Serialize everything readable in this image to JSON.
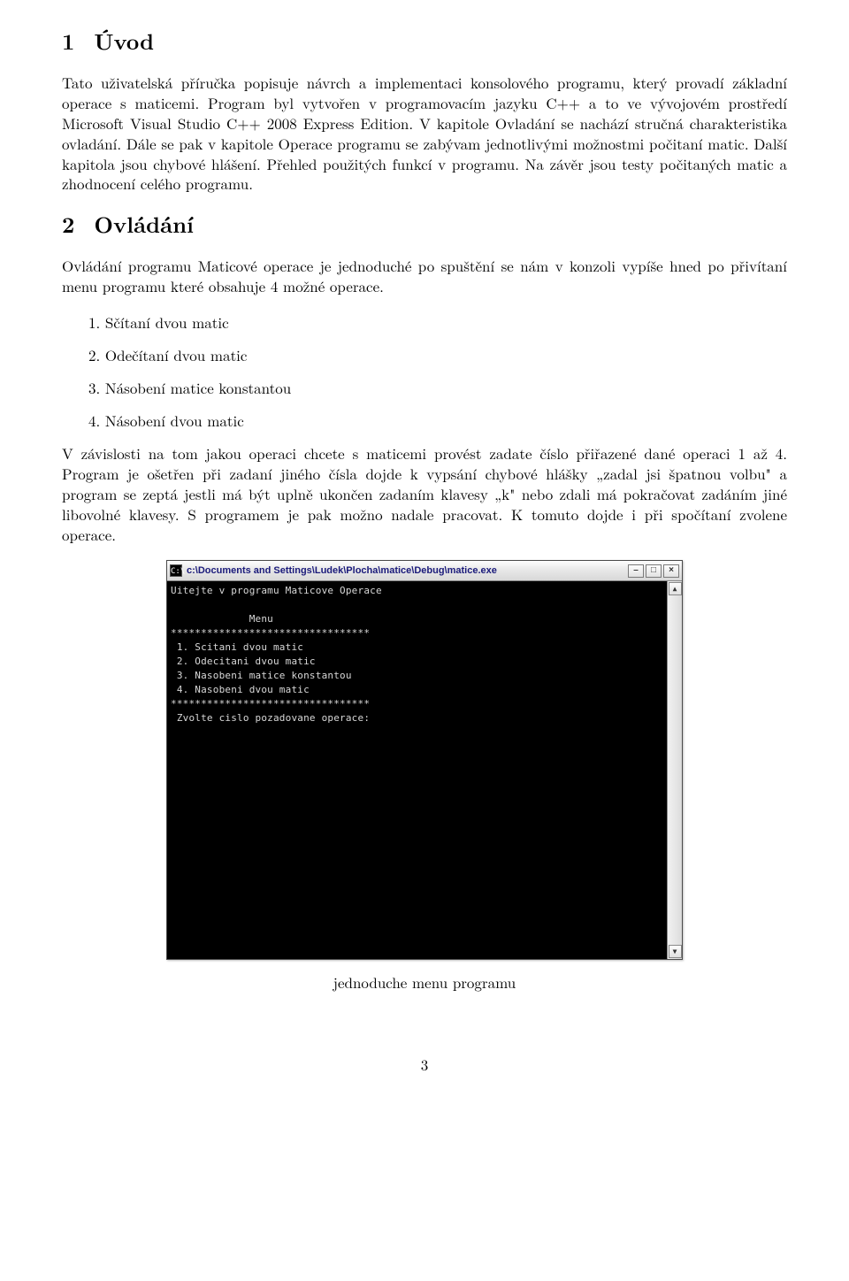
{
  "section1": {
    "num": "1",
    "title": "Úvod",
    "para": "Tato uživatelská příručka popisuje návrch a implementaci konsolového programu, který provadí základní operace s maticemi. Program byl vytvořen v programovacím jazyku C++ a to ve vývojovém prostředí Microsoft Visual Studio C++ 2008 Express Edition. V kapitole Ovladání se nachází stručná charakteristika ovladání. Dále se pak v kapitole Operace programu se zabývam jednotlivými možnostmi počitaní matic. Další kapitola jsou chybové hlášení. Přehled použitých funkcí v programu. Na závěr jsou testy počitaných matic a zhodnocení celého programu."
  },
  "section2": {
    "num": "2",
    "title": "Ovládání",
    "intro": "Ovládání programu Maticové operace je jednoduché po spuštění se nám v konzoli vypíše hned po přivítaní menu programu které obsahuje 4 možné operace.",
    "items": [
      "1. Sčítaní dvou matic",
      "2. Odečítaní dvou matic",
      "3. Násobení matice konstantou",
      "4. Násobení dvou matic"
    ],
    "after": "V závislosti na tom jakou operaci chcete s maticemi provést zadate číslo přiřazené dané operaci 1 až 4. Program je ošetřen při zadaní jiného čísla dojde k vypsání chybové hlášky „zadal jsi špatnou volbu\" a program se zeptá jestli má být uplně ukončen zadaním klavesy „k\" nebo zdali má pokračovat zadáním jiné libovolné klavesy. S programem je pak možno nadale pracovat. K tomuto dojde i při spočítaní zvolene operace."
  },
  "console": {
    "icon_label": "C:\\",
    "title": "c:\\Documents and Settings\\Ludek\\Plocha\\matice\\Debug\\matice.exe",
    "min_label": "–",
    "max_label": "□",
    "close_label": "×",
    "scroll_up": "▲",
    "scroll_down": "▼",
    "lines": [
      "Uitejte v programu Maticove Operace",
      "",
      "             Menu",
      "*********************************",
      " 1. Scitani dvou matic",
      " 2. Odecitani dvou matic",
      " 3. Nasobeni matice konstantou",
      " 4. Nasobeni dvou matic",
      "*********************************",
      " Zvolte cislo pozadovane operace:"
    ]
  },
  "caption": "jednoduche menu programu",
  "page_number": "3"
}
